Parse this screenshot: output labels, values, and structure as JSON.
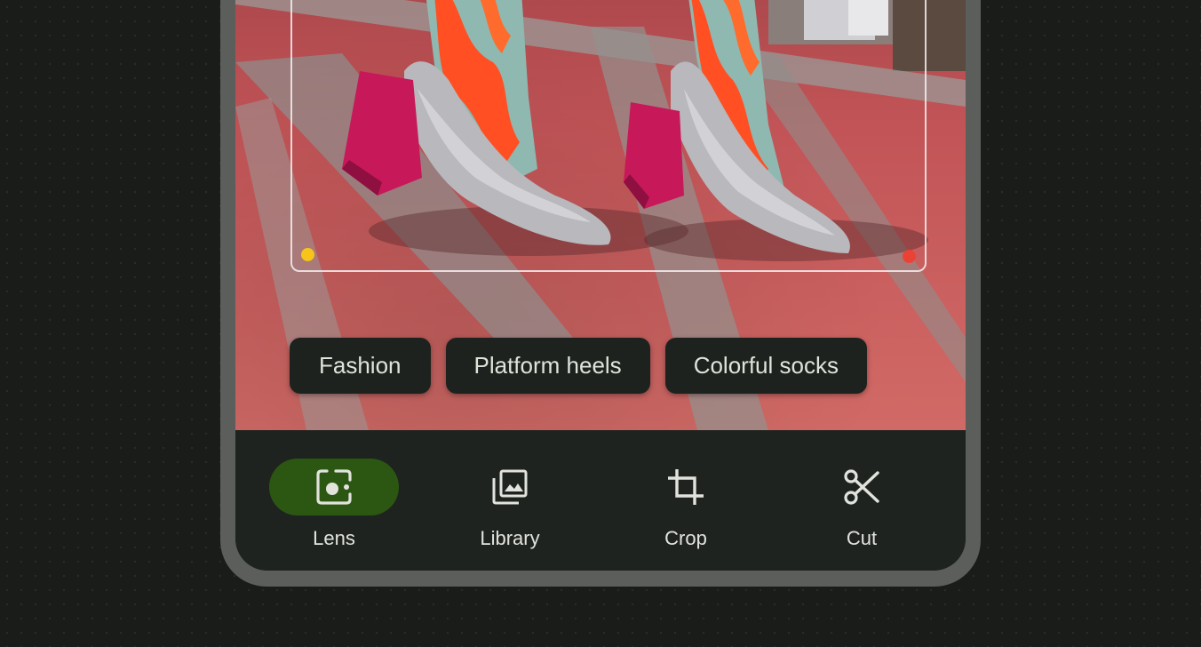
{
  "photo": {
    "subject": "shoes-and-socks-photo"
  },
  "selection": {
    "corner_colors": [
      "#f7c41a",
      "#ea4335"
    ]
  },
  "chips": [
    {
      "label": "Fashion"
    },
    {
      "label": "Platform heels"
    },
    {
      "label": "Colorful socks"
    }
  ],
  "nav": {
    "active_index": 0,
    "active_color": "#2c5713",
    "items": [
      {
        "label": "Lens",
        "icon": "lens-icon"
      },
      {
        "label": "Library",
        "icon": "library-icon"
      },
      {
        "label": "Crop",
        "icon": "crop-icon"
      },
      {
        "label": "Cut",
        "icon": "cut-icon"
      }
    ]
  }
}
